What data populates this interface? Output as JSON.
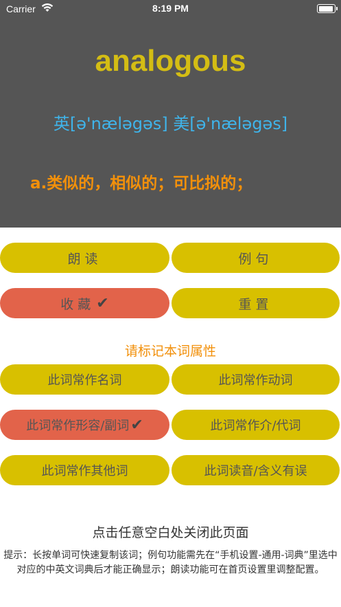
{
  "status_bar": {
    "carrier": "Carrier",
    "time": "8:19 PM",
    "wifi_icon": "wifi-icon",
    "battery_icon": "battery-icon"
  },
  "word": {
    "text": "analogous",
    "phonetic": "英[ə'næləgəs] 美[ə'næləgəs]",
    "meaning": "a.类似的，相似的；可比拟的；"
  },
  "actions": {
    "read_aloud": "朗读",
    "example": "例句",
    "favorite": "收藏",
    "reset": "重置"
  },
  "attributes": {
    "title": "请标记本词属性",
    "noun": "此词常作名词",
    "verb": "此词常作动词",
    "adj_adv": "此词常作形容/副词",
    "prep_pron": "此词常作介/代词",
    "other": "此词常作其他词",
    "error": "此词读音/含义有误"
  },
  "footer": {
    "close_hint": "点击任意空白处关闭此页面",
    "tip": "提示：长按单词可快速复制该词；例句功能需先在“手机设置-通用-词典”里选中对应的中英文词典后才能正确显示；朗读功能可在首页设置里调整配置。"
  },
  "colors": {
    "panel_bg": "#555555",
    "word": "#d4bd14",
    "phonetic": "#3fb4ea",
    "meaning": "#f2900b",
    "button": "#d8c000",
    "button_active": "#e2634a"
  },
  "check_icon": "checkmark-icon",
  "check_mark": "✔"
}
